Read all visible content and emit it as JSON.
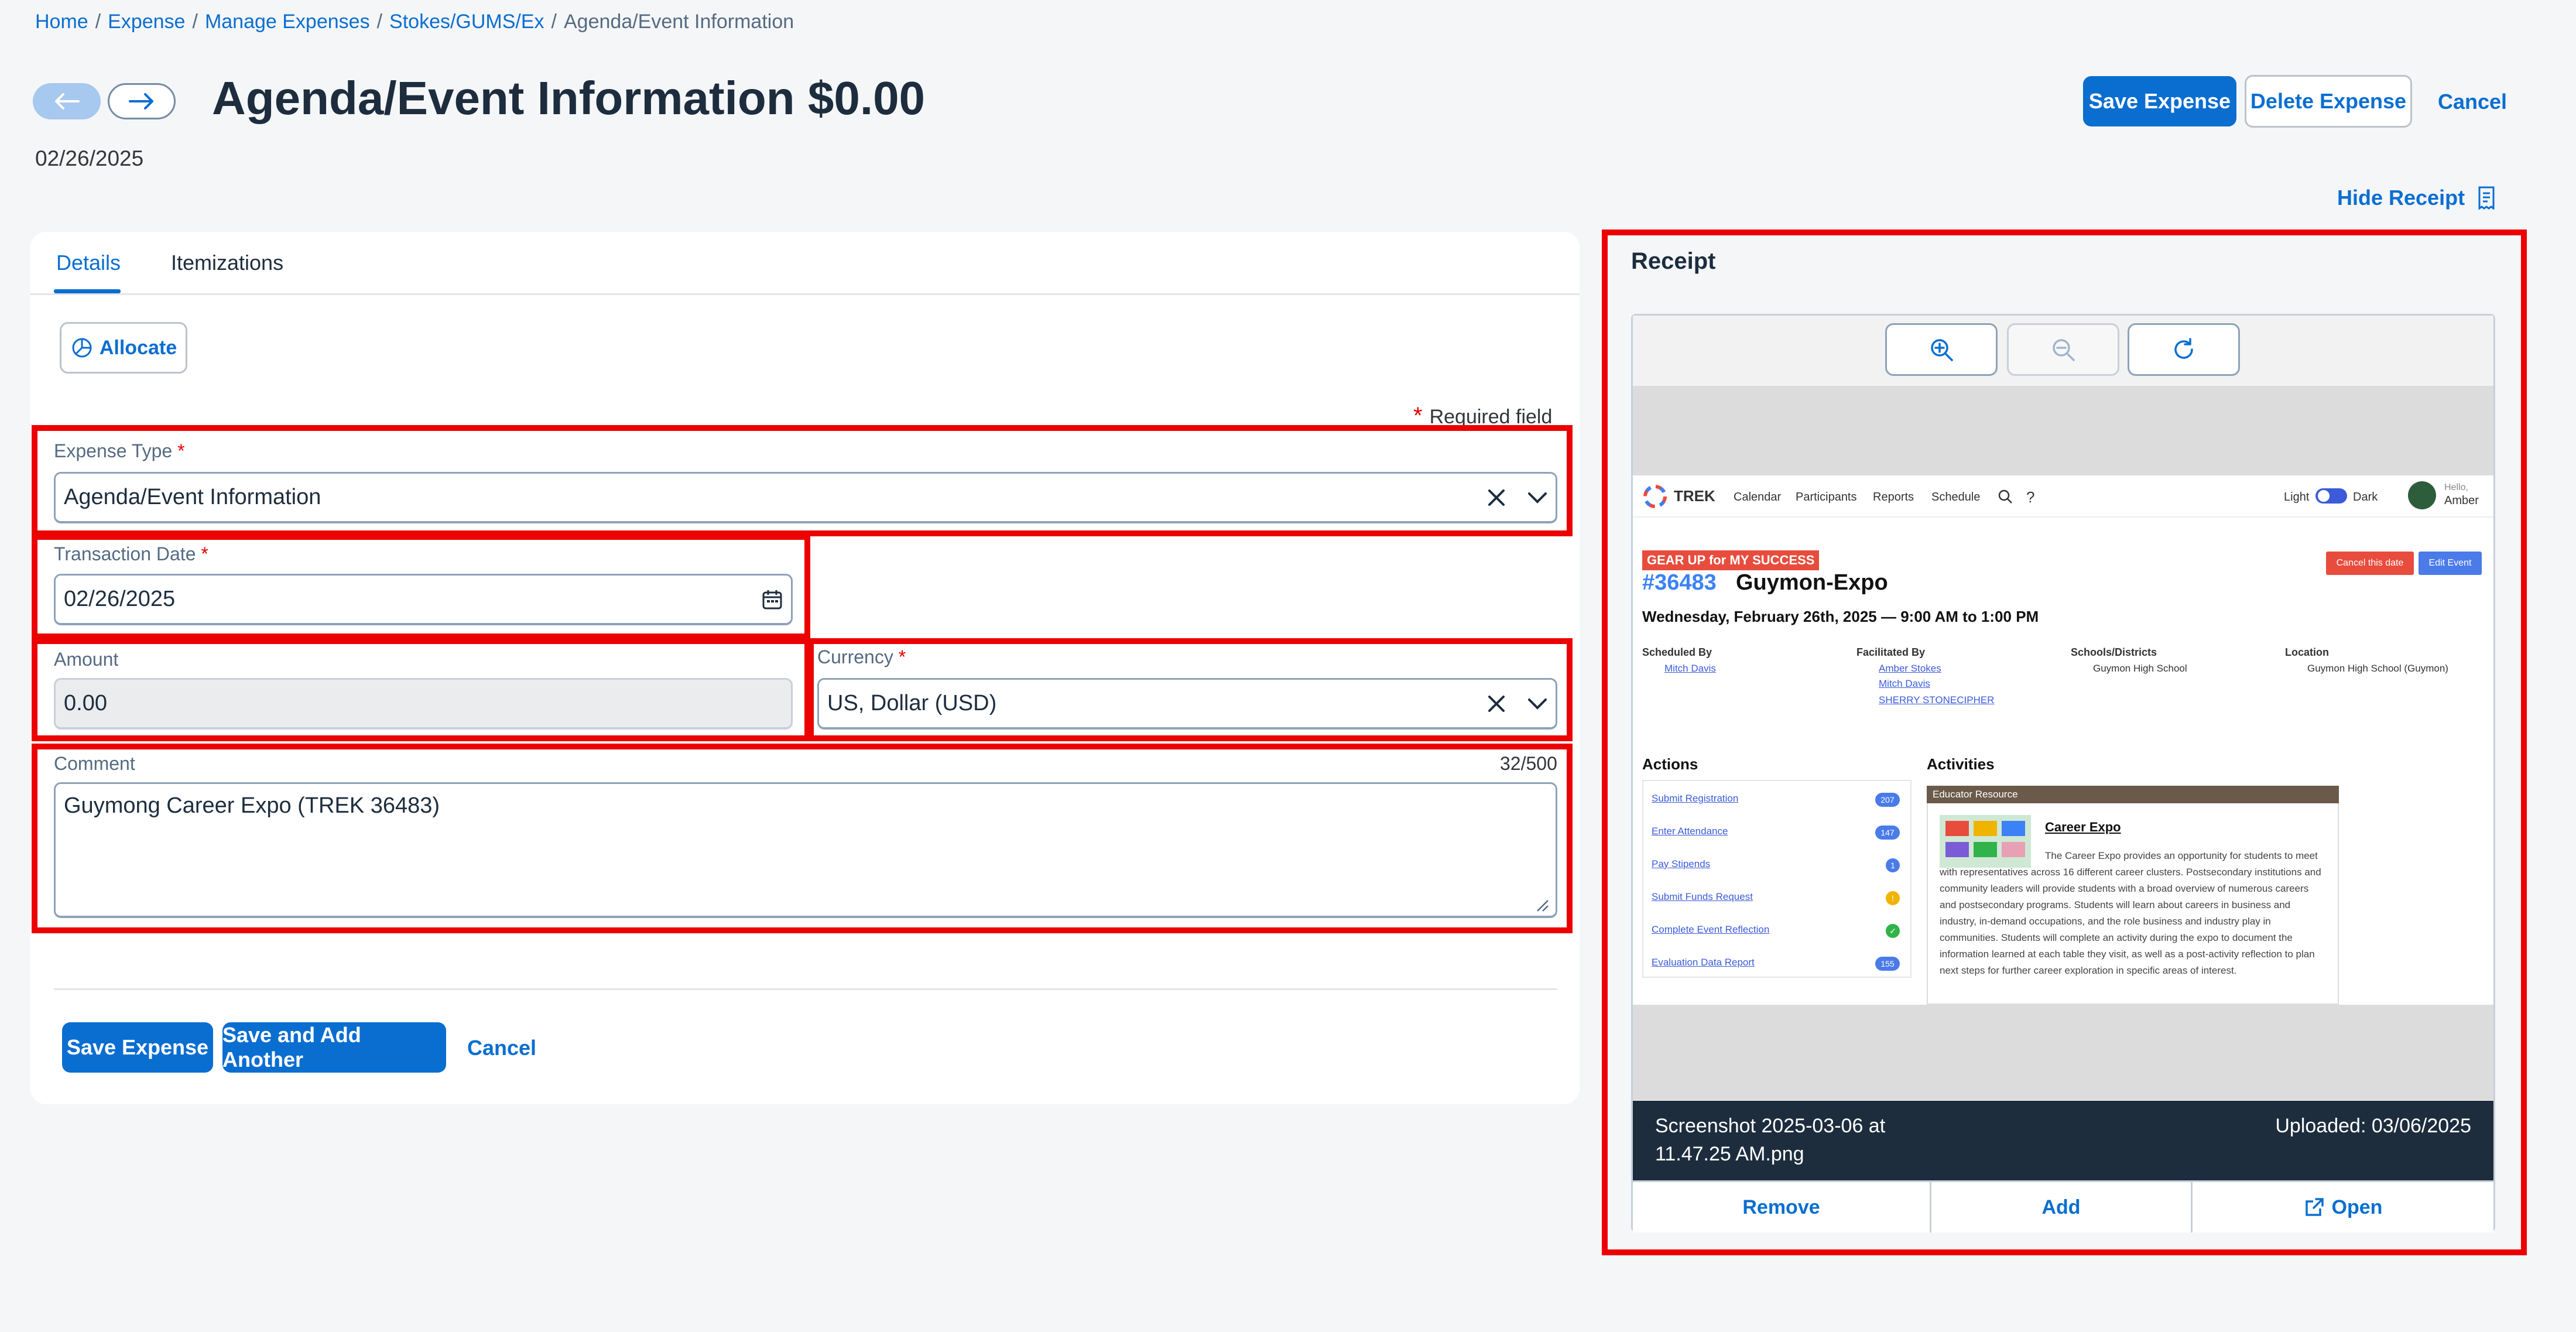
{
  "breadcrumb": {
    "items": [
      "Home",
      "Expense",
      "Manage Expenses",
      "Stokes/GUMS/Ex"
    ],
    "current": "Agenda/Event Information",
    "separator": "/"
  },
  "header": {
    "title": "Agenda/Event Information $0.00",
    "date": "02/26/2025",
    "save_label": "Save Expense",
    "delete_label": "Delete Expense",
    "cancel_label": "Cancel",
    "hide_receipt_label": "Hide Receipt"
  },
  "tabs": [
    {
      "label": "Details",
      "active": true
    },
    {
      "label": "Itemizations",
      "active": false
    }
  ],
  "allocate_label": "Allocate",
  "required_note": "Required field",
  "form": {
    "expense_type": {
      "label": "Expense Type",
      "value": "Agenda/Event Information"
    },
    "transaction_date": {
      "label": "Transaction Date",
      "value": "02/26/2025"
    },
    "amount": {
      "label": "Amount",
      "value": "0.00"
    },
    "currency": {
      "label": "Currency",
      "value": "US, Dollar (USD)"
    },
    "comment": {
      "label": "Comment",
      "counter": "32/500",
      "value": "Guymong Career Expo (TREK 36483)"
    }
  },
  "footer_buttons": {
    "save": "Save Expense",
    "save_add": "Save and Add Another",
    "cancel": "Cancel"
  },
  "receipt": {
    "title": "Receipt",
    "filename": "Screenshot 2025-03-06 at 11.47.25 AM.png",
    "filename_line1": "Screenshot 2025-03-06 at",
    "filename_line2": "11.47.25 AM.png",
    "uploaded": "Uploaded: 03/06/2025",
    "actions": {
      "remove": "Remove",
      "add": "Add",
      "open": "Open"
    },
    "preview": {
      "app_name": "TREK",
      "nav": [
        "Calendar",
        "Participants",
        "Reports",
        "Schedule"
      ],
      "theme_light": "Light",
      "theme_dark": "Dark",
      "user_greeting": "Hello,",
      "user_name": "Amber",
      "banner": "GEAR UP for MY SUCCESS",
      "event_id": "#36483",
      "event_name": "Guymon-Expo",
      "event_time": "Wednesday, February 26th, 2025 — 9:00 AM to 1:00 PM",
      "cancel_btn": "Cancel this date",
      "edit_btn": "Edit Event",
      "scheduled_by_label": "Scheduled By",
      "scheduled_by": [
        "Mitch Davis"
      ],
      "facilitated_by_label": "Facilitated By",
      "facilitated_by": [
        "Amber Stokes",
        "Mitch Davis",
        "SHERRY STONECIPHER"
      ],
      "schools_label": "Schools/Districts",
      "schools": [
        "Guymon High School"
      ],
      "location_label": "Location",
      "location": [
        "Guymon High School (Guymon)"
      ],
      "actions_label": "Actions",
      "actions": [
        {
          "label": "Submit Registration",
          "badge": "207",
          "color": "#4a7be8"
        },
        {
          "label": "Enter Attendance",
          "badge": "147",
          "color": "#4a7be8"
        },
        {
          "label": "Pay Stipends",
          "badge": "1",
          "color": "#4a7be8"
        },
        {
          "label": "Submit Funds Request",
          "badge": "!",
          "color": "#f0b400"
        },
        {
          "label": "Complete Event Reflection",
          "badge": "✓",
          "color": "#2fb34a"
        },
        {
          "label": "Evaluation Data Report",
          "badge": "155",
          "color": "#4a7be8"
        }
      ],
      "activities_label": "Activities",
      "resource_header": "Educator Resource",
      "resource_title": "Career Expo",
      "resource_text": "The Career Expo provides an opportunity for students to meet with representatives across 16 different career clusters. Postsecondary institutions and community leaders will provide students with a broad overview of numerous careers and postsecondary programs. Students will learn about careers in business and industry, in-demand occupations, and the role business and industry play in communities. Students will complete an activity during the expo to document the information learned at each table they visit, as well as a post-activity reflection to plan next steps for further career exploration in specific areas of interest."
    }
  },
  "colors": {
    "accent": "#0a6ed1",
    "highlight": "#ec0000",
    "receipt_footer": "#1d2d3e"
  }
}
